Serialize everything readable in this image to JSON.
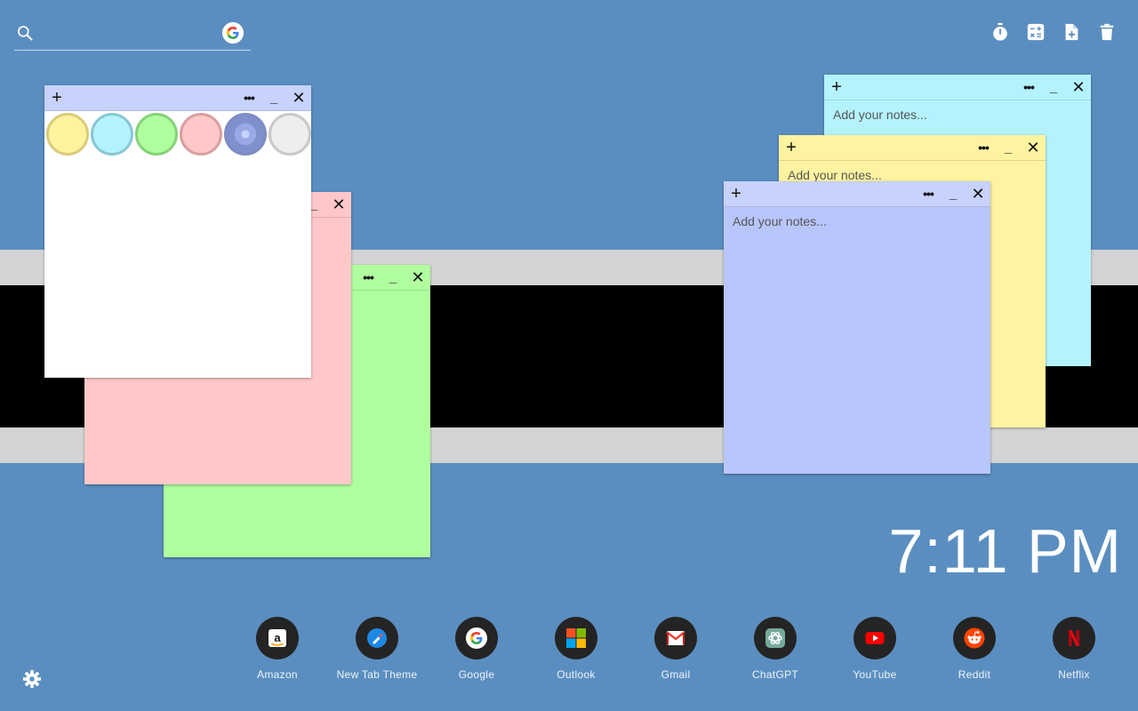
{
  "search": {
    "placeholder": "",
    "value": ""
  },
  "toolbar": {
    "icons": [
      "timer-icon",
      "calculator-icon",
      "new-note-icon",
      "trash-icon"
    ]
  },
  "colors": {
    "background": "#5b8ec0",
    "note_white": "#ffffff",
    "note_pink": "#ffc8c8",
    "note_green": "#b0ff9f",
    "note_cyan": "#b4f3fd",
    "note_yellow": "#fdf3a0",
    "note_lavender": "#b8c6fd",
    "bar_lavender": "#c7d2fd"
  },
  "notes": {
    "palette": {
      "swatches": [
        "yellow",
        "cyan",
        "green",
        "pink",
        "lavender",
        "gray"
      ]
    },
    "cyan": {
      "placeholder": "Add your notes..."
    },
    "yellow": {
      "placeholder": "Add your notes..."
    },
    "lavender": {
      "placeholder": "Add your notes..."
    }
  },
  "clock": {
    "time": "7:11 PM"
  },
  "shortcuts": [
    {
      "label": "Amazon",
      "icon": "amazon-icon"
    },
    {
      "label": "New Tab Theme",
      "icon": "new-tab-theme-icon"
    },
    {
      "label": "Google",
      "icon": "google-icon"
    },
    {
      "label": "Outlook",
      "icon": "outlook-icon"
    },
    {
      "label": "Gmail",
      "icon": "gmail-icon"
    },
    {
      "label": "ChatGPT",
      "icon": "chatgpt-icon"
    },
    {
      "label": "YouTube",
      "icon": "youtube-icon"
    },
    {
      "label": "Reddit",
      "icon": "reddit-icon"
    },
    {
      "label": "Netflix",
      "icon": "netflix-icon"
    }
  ],
  "settings": {
    "icon": "gear-icon"
  }
}
